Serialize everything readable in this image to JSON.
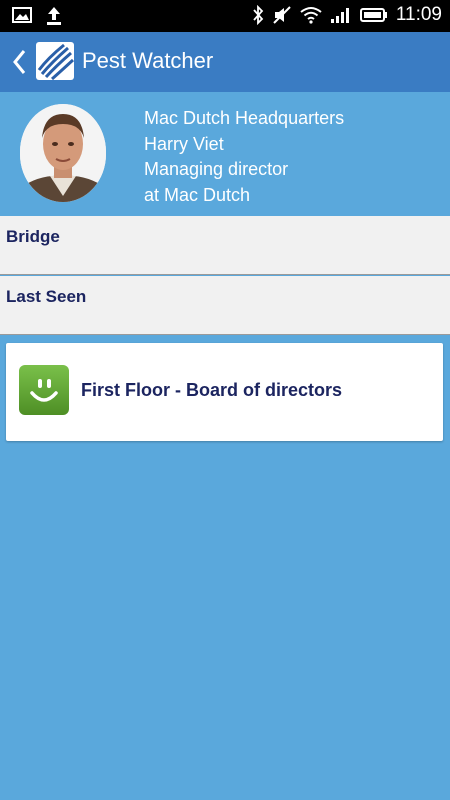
{
  "status_bar": {
    "time": "11:09",
    "icons": [
      "image-icon",
      "upload-icon",
      "bluetooth-icon",
      "mute-icon",
      "wifi-icon",
      "signal-icon",
      "battery-icon"
    ]
  },
  "app_bar": {
    "title": "Pest Watcher"
  },
  "profile": {
    "location": "Mac Dutch Headquarters",
    "name": "Harry Viet",
    "role": "Managing director",
    "company": "at Mac Dutch"
  },
  "sections": {
    "bridge_label": "Bridge",
    "last_seen_label": "Last Seen"
  },
  "card": {
    "title": "First Floor - Board of directors"
  },
  "colors": {
    "app_bar": "#3a7cc3",
    "background": "#5aa8dc",
    "section_bg": "#f1f1f1",
    "text_dark": "#1c2560",
    "smiley_green": "#6aa93a"
  }
}
